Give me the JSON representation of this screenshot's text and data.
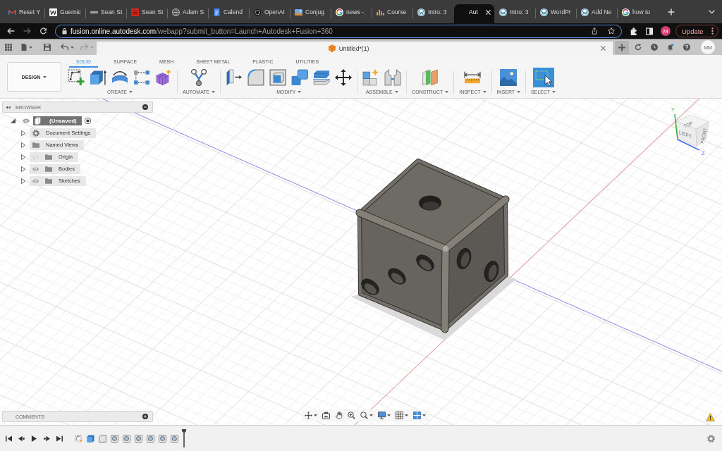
{
  "browser_tabs": [
    {
      "title": "Reset Y",
      "selected": false
    },
    {
      "title": "Guernic",
      "selected": false
    },
    {
      "title": "Sean St",
      "selected": false
    },
    {
      "title": "Sean St",
      "selected": false
    },
    {
      "title": "Adam S",
      "selected": false
    },
    {
      "title": "Calend",
      "selected": false
    },
    {
      "title": "OpenAI",
      "selected": false
    },
    {
      "title": "Conjug",
      "selected": false
    },
    {
      "title": "news -",
      "selected": false
    },
    {
      "title": "Course",
      "selected": false
    },
    {
      "title": "Intro: 3",
      "selected": false
    },
    {
      "title": "Aut",
      "selected": true
    },
    {
      "title": "Intro: 3",
      "selected": false
    },
    {
      "title": "WordPr",
      "selected": false
    },
    {
      "title": "Add Ne",
      "selected": false
    },
    {
      "title": "how to",
      "selected": false
    }
  ],
  "browser_nav": {
    "back_enabled": true,
    "forward_enabled": false
  },
  "address_bar": {
    "host": "fusion.online.autodesk.com",
    "path": "/webapp?submit_button=Launch+Autodesk+Fusion+360"
  },
  "profile": {
    "initial": "M"
  },
  "update_button": {
    "label": "Update"
  },
  "quick_access": {
    "undo_enabled": true,
    "redo_enabled": false
  },
  "document_tab": {
    "title": "Untitled*(1)"
  },
  "user": {
    "initials": "MM"
  },
  "toolbar": {
    "workspace": "DESIGN",
    "tabs": [
      {
        "label": "SOLID",
        "selected": true
      },
      {
        "label": "SURFACE",
        "selected": false
      },
      {
        "label": "MESH",
        "selected": false
      },
      {
        "label": "SHEET METAL",
        "selected": false
      },
      {
        "label": "PLASTIC",
        "selected": false
      },
      {
        "label": "UTILITIES",
        "selected": false
      }
    ],
    "groups": [
      {
        "label": "CREATE"
      },
      {
        "label": "AUTOMATE"
      },
      {
        "label": "MODIFY"
      },
      {
        "label": "ASSEMBLE"
      },
      {
        "label": "CONSTRUCT"
      },
      {
        "label": "INSPECT"
      },
      {
        "label": "INSERT"
      },
      {
        "label": "SELECT"
      }
    ]
  },
  "browser_panel": {
    "title": "BROWSER",
    "root": {
      "label": "(Unsaved)",
      "selected": true,
      "expanded": true,
      "visible": true,
      "children": [
        {
          "label": "Document Settings",
          "kind": "settings",
          "selected": false,
          "expanded": false
        },
        {
          "label": "Named Views",
          "kind": "views",
          "selected": false,
          "expanded": false
        },
        {
          "label": "Origin",
          "kind": "folder",
          "selected": false,
          "expanded": false,
          "visible": false
        },
        {
          "label": "Bodies",
          "kind": "folder",
          "selected": false,
          "expanded": false,
          "visible": true
        },
        {
          "label": "Sketches",
          "kind": "folder",
          "selected": false,
          "expanded": false,
          "visible": true
        }
      ]
    }
  },
  "view_cube": {
    "top_label": "TOP",
    "left_label": "LEFT",
    "right_label": "FRONT",
    "axes": [
      {
        "label": "Y",
        "color": "#3cb043"
      },
      {
        "label": "Z",
        "color": "#4a6cf7"
      }
    ]
  },
  "comments_panel": {
    "title": "COMMENTS"
  }
}
